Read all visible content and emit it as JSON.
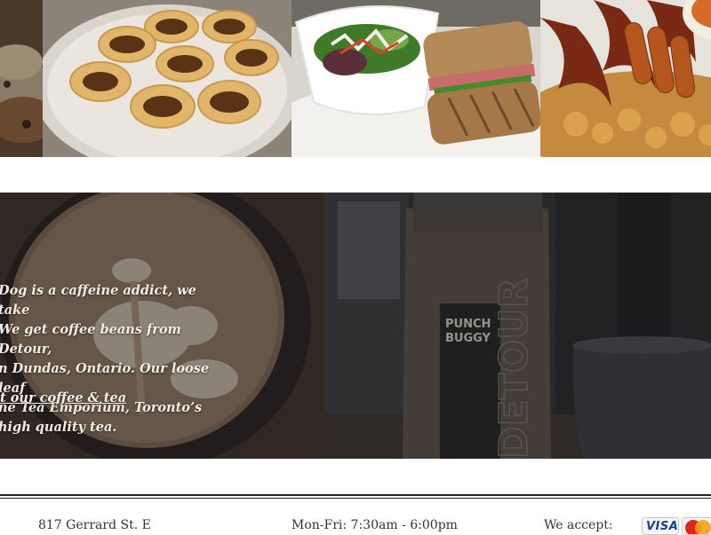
{
  "gallery": {
    "photos": [
      {
        "icon": "food-photo-cookies"
      },
      {
        "icon": "food-photo-butter-tarts"
      },
      {
        "icon": "food-photo-salad-sandwich"
      },
      {
        "icon": "food-photo-bacon-sausage-hashbrowns"
      }
    ]
  },
  "coffee_section": {
    "text": "Dog is a caffeine addict, we take\nWe get coffee beans from Detour,\nn Dundas, Ontario. Our loose leaf\nne Tea Emporium, Toronto’s\nhigh quality tea.",
    "link": "t our coffee & tea",
    "bag_brand": "PUNCH\nBUGGY",
    "bag_vertical": "DETOUR"
  },
  "footer": {
    "address": "817 Gerrard St. E",
    "hours": "Mon-Fri: 7:30am - 6:00pm",
    "accept_label": "We accept:",
    "cards": [
      "VISA",
      "mastercard"
    ]
  },
  "colors": {
    "overlay_text": "#f1ece4",
    "rule": "#222222",
    "footer_text": "#333333"
  }
}
